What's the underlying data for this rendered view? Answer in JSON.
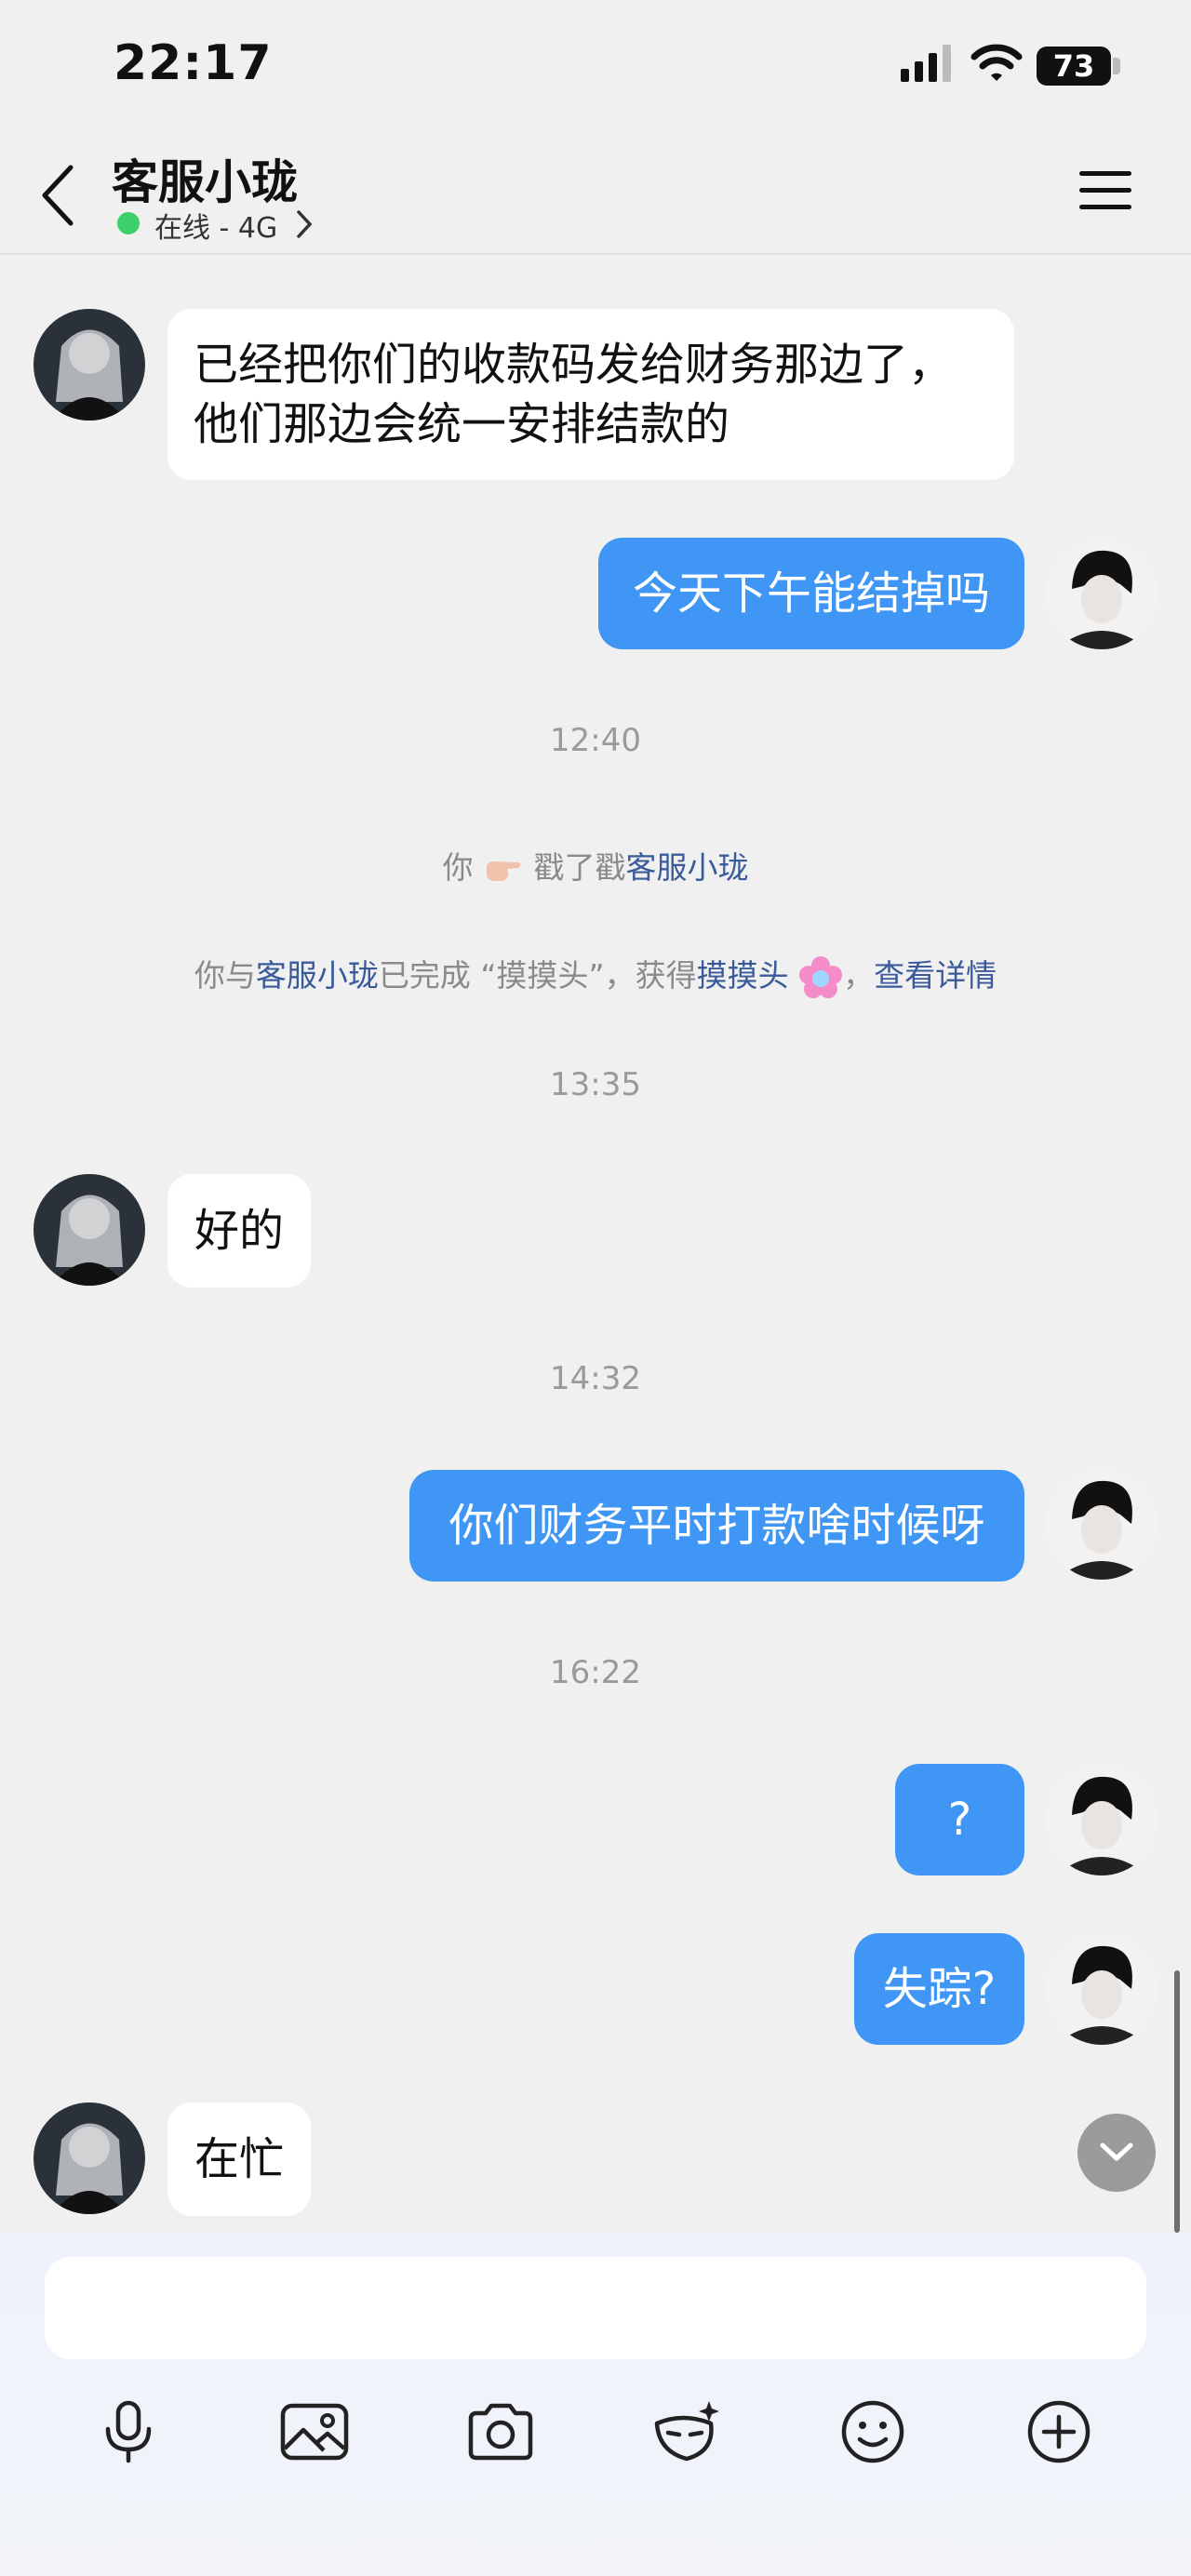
{
  "status": {
    "time": "22:17",
    "battery": "73"
  },
  "header": {
    "title": "客服小珑",
    "subtitle": "在线 - 4G"
  },
  "messages": {
    "m1": "已经把你们的收款码发给财务那边了，",
    "m1b": "他们那边会统一安排结款的",
    "m2": "今天下午能结掉吗",
    "ts1": "12:40",
    "poke": {
      "you": "你",
      "action": "戳了戳",
      "target": "客服小珑"
    },
    "achieve": {
      "p1": "你与",
      "name": "客服小珑",
      "p2": "已完成 “摸摸头”，获得",
      "badge": "摸摸头",
      "p3": "，",
      "detail": "查看详情"
    },
    "ts2": "13:35",
    "m3": "好的",
    "ts3": "14:32",
    "m4": "你们财务平时打款啥时候呀",
    "ts4": "16:22",
    "m5": "?",
    "m6": "失踪?",
    "m7": "在忙"
  },
  "toolbar": [
    "microphone-icon",
    "image-icon",
    "camera-icon",
    "vision-icon",
    "emoji-icon",
    "plus-icon"
  ]
}
